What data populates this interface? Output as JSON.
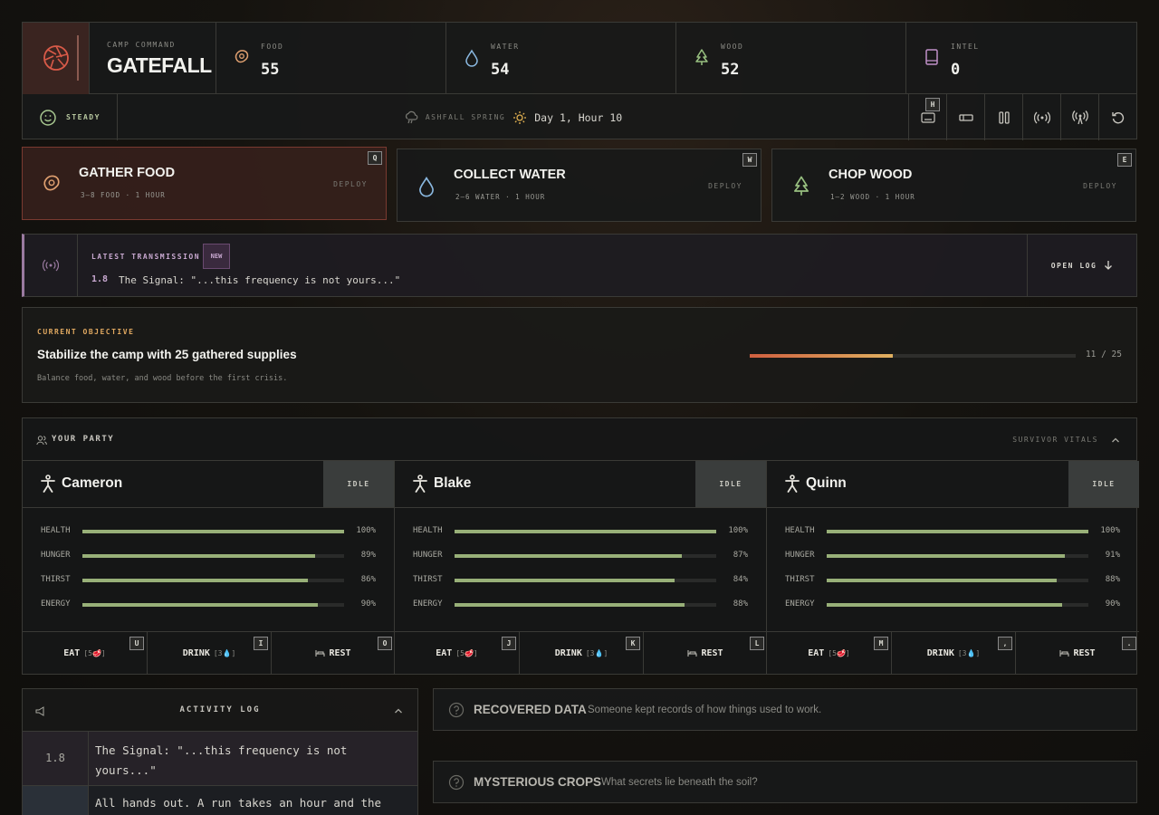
{
  "header": {
    "camp_label": "CAMP COMMAND",
    "camp_name": "GATEFALL",
    "resources": [
      {
        "label": "FOOD",
        "value": "55",
        "icon": "meat-icon",
        "color": "#e0a070"
      },
      {
        "label": "WATER",
        "value": "54",
        "icon": "water-drop-icon",
        "color": "#8ab8e0"
      },
      {
        "label": "WOOD",
        "value": "52",
        "icon": "tree-icon",
        "color": "#98c080"
      },
      {
        "label": "INTEL",
        "value": "0",
        "icon": "book-icon",
        "color": "#c090c8"
      }
    ],
    "status": "STEADY",
    "weather": "ASHFALL SPRING",
    "day": "Day 1, Hour 10",
    "tools": [
      {
        "icon": "keyboard-icon",
        "key": "H"
      },
      {
        "icon": "speed-icon",
        "key": ""
      },
      {
        "icon": "pause-icon",
        "key": ""
      },
      {
        "icon": "signal-icon",
        "key": ""
      },
      {
        "icon": "antenna-icon",
        "key": ""
      },
      {
        "icon": "reset-icon",
        "key": ""
      }
    ]
  },
  "actions": [
    {
      "title": "GATHER FOOD",
      "sub": "3–8 FOOD · 1 HOUR",
      "deploy": "DEPLOY",
      "key": "Q"
    },
    {
      "title": "COLLECT WATER",
      "sub": "2–6 WATER · 1 HOUR",
      "deploy": "DEPLOY",
      "key": "W"
    },
    {
      "title": "CHOP WOOD",
      "sub": "1–2 WOOD · 1 HOUR",
      "deploy": "DEPLOY",
      "key": "E"
    }
  ],
  "transmission": {
    "label": "LATEST TRANSMISSION",
    "badge": "NEW",
    "number": "1.8",
    "message": "The Signal: \"...this frequency is not yours...\"",
    "open_log": "OPEN LOG"
  },
  "objective": {
    "label": "CURRENT OBJECTIVE",
    "title": "Stabilize the camp with 25 gathered supplies",
    "desc": "Balance food, water, and wood before the first crisis.",
    "progress": 0.44,
    "count": "11 / 25"
  },
  "party": {
    "label": "YOUR PARTY",
    "vitals": "SURVIVOR VITALS",
    "members": [
      {
        "name": "Cameron",
        "state": "IDLE",
        "stats": [
          {
            "label": "HEALTH",
            "pct": 100,
            "text": "100%"
          },
          {
            "label": "HUNGER",
            "pct": 89,
            "text": "89%"
          },
          {
            "label": "THIRST",
            "pct": 86,
            "text": "86%"
          },
          {
            "label": "ENERGY",
            "pct": 90,
            "text": "90%"
          }
        ],
        "actions": [
          {
            "label": "EAT",
            "cost": "[5🥩]",
            "key": "U"
          },
          {
            "label": "DRINK",
            "cost": "[3💧]",
            "key": "I"
          },
          {
            "label": "REST",
            "cost": "",
            "key": "O"
          }
        ]
      },
      {
        "name": "Blake",
        "state": "IDLE",
        "stats": [
          {
            "label": "HEALTH",
            "pct": 100,
            "text": "100%"
          },
          {
            "label": "HUNGER",
            "pct": 87,
            "text": "87%"
          },
          {
            "label": "THIRST",
            "pct": 84,
            "text": "84%"
          },
          {
            "label": "ENERGY",
            "pct": 88,
            "text": "88%"
          }
        ],
        "actions": [
          {
            "label": "EAT",
            "cost": "[5🥩]",
            "key": "J"
          },
          {
            "label": "DRINK",
            "cost": "[3💧]",
            "key": "K"
          },
          {
            "label": "REST",
            "cost": "",
            "key": "L"
          }
        ]
      },
      {
        "name": "Quinn",
        "state": "IDLE",
        "stats": [
          {
            "label": "HEALTH",
            "pct": 100,
            "text": "100%"
          },
          {
            "label": "HUNGER",
            "pct": 91,
            "text": "91%"
          },
          {
            "label": "THIRST",
            "pct": 88,
            "text": "88%"
          },
          {
            "label": "ENERGY",
            "pct": 90,
            "text": "90%"
          }
        ],
        "actions": [
          {
            "label": "EAT",
            "cost": "[5🥩]",
            "key": "M"
          },
          {
            "label": "DRINK",
            "cost": "[3💧]",
            "key": ","
          },
          {
            "label": "REST",
            "cost": "",
            "key": "."
          }
        ]
      }
    ]
  },
  "log": {
    "label": "ACTIVITY LOG",
    "entries": [
      {
        "num": "1.8",
        "text": "The Signal: \"...this frequency is not yours...\""
      },
      {
        "num": "",
        "text": "All hands out. A run takes an hour and the"
      }
    ]
  },
  "panels": [
    {
      "title": "RECOVERED DATA",
      "desc": "Someone kept records of how things used to work."
    },
    {
      "title": "MYSTERIOUS CROPS",
      "desc": "What secrets lie beneath the soil?"
    }
  ]
}
